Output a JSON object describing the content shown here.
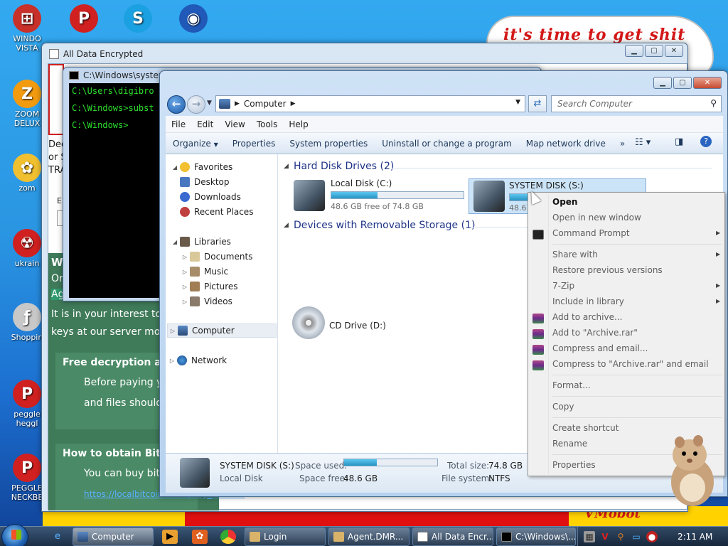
{
  "wallpaper": {
    "cloud_text": "it's time to get shit",
    "bottom_logo": "VMobot"
  },
  "desktop_icons": [
    {
      "name": "windows-vista-icon",
      "label": "WINDO\nVISTA",
      "color": "#c8302a",
      "glyph": "⊞"
    },
    {
      "name": "peggle-icon",
      "label": "",
      "color": "#d02020",
      "glyph": "P"
    },
    {
      "name": "skype-icon",
      "label": "",
      "color": "#1ba1e2",
      "glyph": "S"
    },
    {
      "name": "globe-icon",
      "label": "",
      "color": "#2059b8",
      "glyph": "◉"
    },
    {
      "name": "zoom-deluxe-icon",
      "label": "ZOOM\nDELUX",
      "color": "#f29b10",
      "glyph": "Z"
    },
    {
      "name": "zombie-icon",
      "label": "zom",
      "color": "#f0c030",
      "glyph": "✿"
    },
    {
      "name": "ukraine-icon",
      "label": "ukrain",
      "color": "#d02020",
      "glyph": "☢"
    },
    {
      "name": "shopping-icon",
      "label": "Shoppin",
      "color": "#c8c8c8",
      "glyph": "ƒ"
    },
    {
      "name": "peggle-heggle-icon",
      "label": "peggle\nheggl",
      "color": "#d02020",
      "glyph": "P"
    },
    {
      "name": "peggle-neckbeard-icon",
      "label": "PEGGLE\nNECKBE",
      "color": "#d02020",
      "glyph": "P"
    }
  ],
  "ransom_window": {
    "title": "All Data Encrypted",
    "frag_left": [
      "Dec",
      "or S",
      "TRA",
      "Er"
    ],
    "heading_frag": "W",
    "line_or": "Or",
    "line_ag": "Ag",
    "line1": "It is in your interest to r",
    "line2": "keys at our server more",
    "free_heading": "Free decryption as",
    "free_p1": "Before paying you",
    "free_p2": "and files should no",
    "btc_heading": "How to obtain Bitco",
    "btc_p1": "You can buy bitco",
    "btc_link": "https://localbitcoins.com/buy_bitcoins"
  },
  "cmd_window": {
    "title": "C:\\Windows\\system",
    "lines": [
      "C:\\Users\\digibro",
      "C:\\Windows>subst",
      "C:\\Windows>"
    ]
  },
  "explorer": {
    "address": "Computer",
    "search_placeholder": "Search Computer",
    "menu": [
      "File",
      "Edit",
      "View",
      "Tools",
      "Help"
    ],
    "commands": [
      "Organize",
      "Properties",
      "System properties",
      "Uninstall or change a program",
      "Map network drive"
    ],
    "more": "»",
    "nav": {
      "favorites": "Favorites",
      "desktop": "Desktop",
      "downloads": "Downloads",
      "recent": "Recent Places",
      "libraries": "Libraries",
      "documents": "Documents",
      "music": "Music",
      "pictures": "Pictures",
      "videos": "Videos",
      "computer": "Computer",
      "network": "Network"
    },
    "groups": {
      "hard_disks": "Hard Disk Drives (2)",
      "removable": "Devices with Removable Storage (1)"
    },
    "drives": [
      {
        "name": "Local Disk (C:)",
        "free": "48.6 GB free of 74.8 GB",
        "used_fraction": 0.35
      },
      {
        "name": "SYSTEM DISK (S:)",
        "free": "48.6 GB free of 74.8 GB",
        "used_fraction": 0.35
      }
    ],
    "cd_drive": "CD Drive (D:)",
    "details": {
      "name": "SYSTEM DISK (S:)",
      "type": "Local Disk",
      "space_used_label": "Space used:",
      "space_free_label": "Space free:",
      "space_free": "48.6 GB",
      "total_label": "Total size:",
      "total": "74.8 GB",
      "fs_label": "File system:",
      "fs": "NTFS",
      "used_fraction": 0.35
    }
  },
  "context_menu": {
    "items": [
      {
        "label": "Open",
        "bold": true
      },
      {
        "label": "Open in new window"
      },
      {
        "label": "Command Prompt",
        "submenu": true
      },
      {
        "label": "Share with",
        "submenu": true
      },
      {
        "label": "Restore previous versions"
      },
      {
        "label": "7-Zip",
        "submenu": true
      },
      {
        "label": "Include in library",
        "submenu": true
      },
      {
        "label": "Add to archive..."
      },
      {
        "label": "Add to \"Archive.rar\""
      },
      {
        "label": "Compress and email..."
      },
      {
        "label": "Compress to \"Archive.rar\" and email"
      },
      {
        "label": "Format..."
      },
      {
        "label": "Copy"
      },
      {
        "label": "Create shortcut"
      },
      {
        "label": "Rename"
      },
      {
        "label": "Properties"
      }
    ]
  },
  "taskbar": {
    "buttons": [
      {
        "label": "Computer",
        "active": true
      },
      {
        "label": "Login"
      },
      {
        "label": "Agent.DMR..."
      },
      {
        "label": "All Data Encr..."
      },
      {
        "label": "C:\\Windows\\..."
      }
    ],
    "clock": "2:11 AM"
  },
  "colors": {
    "ransom_green": "#3f7a59",
    "group_heading": "#1e3287",
    "progress": "#2793c4"
  }
}
